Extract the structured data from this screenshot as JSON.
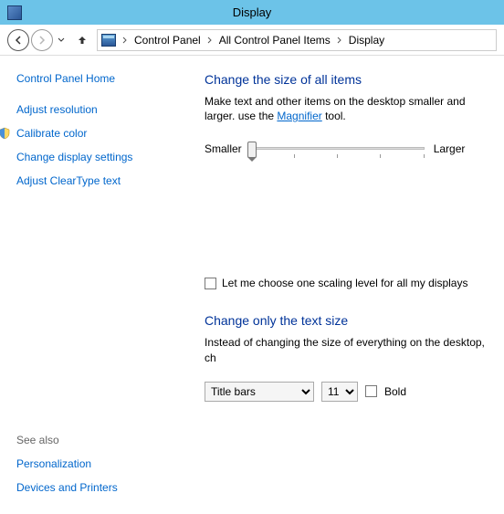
{
  "window": {
    "title": "Display"
  },
  "breadcrumbs": {
    "item0": "Control Panel",
    "item1": "All Control Panel Items",
    "item2": "Display"
  },
  "sidebar": {
    "home": "Control Panel Home",
    "links": {
      "l0": "Adjust resolution",
      "l1": "Calibrate color",
      "l2": "Change display settings",
      "l3": "Adjust ClearType text"
    },
    "see_also_label": "See also",
    "see_also": {
      "s0": "Personalization",
      "s1": "Devices and Printers"
    }
  },
  "main": {
    "heading1": "Change the size of all items",
    "para1a": "Make text and other items on the desktop smaller and larger. ",
    "para1b": "use the ",
    "magnifier": "Magnifier",
    "para1c": " tool.",
    "slider_min": "Smaller",
    "slider_max": "Larger",
    "checkbox_label": "Let me choose one scaling level for all my displays",
    "heading2": "Change only the text size",
    "para2": "Instead of changing the size of everything on the desktop, ch",
    "select_item": "Title bars",
    "select_size": "11",
    "bold_label": "Bold"
  }
}
